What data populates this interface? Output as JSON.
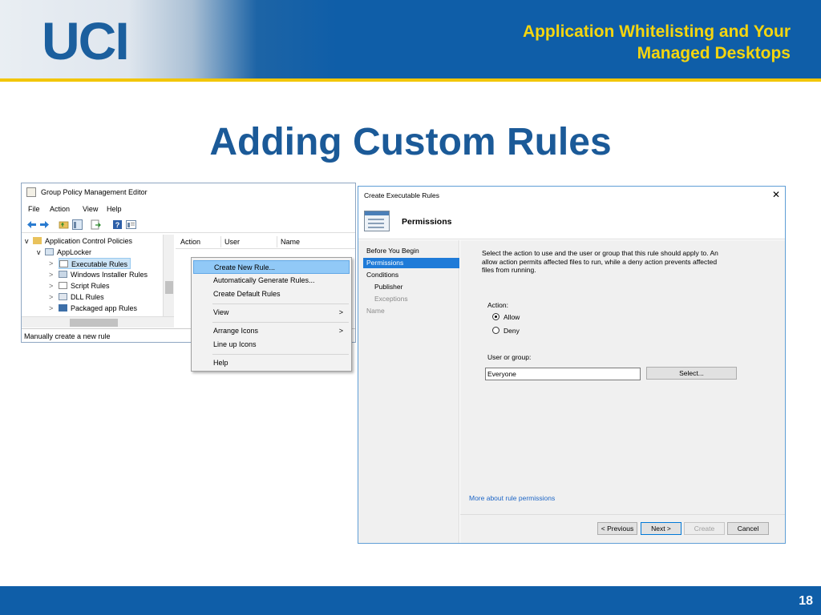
{
  "slide": {
    "logo": "UCI",
    "header_line1": "Application Whitelisting and Your",
    "header_line2": "Managed Desktops",
    "title": "Adding Custom Rules",
    "page_number": "18"
  },
  "colors": {
    "brand_blue": "#0f5ea8",
    "brand_gold": "#f2c500",
    "header_text": "#f5d50f",
    "title_blue": "#1b5a98",
    "selection": "#91c9f7",
    "active_step": "#1f7bd8"
  },
  "gpme": {
    "title": "Group Policy Management Editor",
    "menu": [
      "File",
      "Action",
      "View",
      "Help"
    ],
    "toolbar_icons": [
      "back-arrow-icon",
      "forward-arrow-icon",
      "up-folder-icon",
      "show-hide-tree-icon",
      "export-list-icon",
      "help-icon",
      "properties-icon"
    ],
    "tree": [
      {
        "label": "Application Control Policies",
        "level": 0,
        "expander": "v"
      },
      {
        "label": "AppLocker",
        "level": 1,
        "expander": "v"
      },
      {
        "label": "Executable Rules",
        "level": 2,
        "expander": ">",
        "selected": true
      },
      {
        "label": "Windows Installer Rules",
        "level": 2,
        "expander": ">"
      },
      {
        "label": "Script Rules",
        "level": 2,
        "expander": ">"
      },
      {
        "label": "DLL Rules",
        "level": 2,
        "expander": ">"
      },
      {
        "label": "Packaged app Rules",
        "level": 2,
        "expander": ">"
      }
    ],
    "columns": [
      "Action",
      "User",
      "Name"
    ],
    "status": "Manually create a new rule"
  },
  "context_menu": {
    "items": [
      "Create New Rule...",
      "Automatically Generate Rules...",
      "Create Default Rules",
      "View",
      "Arrange Icons",
      "Line up Icons",
      "Help"
    ],
    "submenu_arrow": ">"
  },
  "dialog": {
    "title": "Create Executable Rules",
    "close": "✕",
    "header": "Permissions",
    "steps": [
      "Before You Begin",
      "Permissions",
      "Conditions",
      "Publisher",
      "Exceptions",
      "Name"
    ],
    "description": "Select the action to use and the user or group that this rule should apply to. An allow action permits affected files to run, while a deny action prevents affected files from running.",
    "action_label": "Action:",
    "allow": "Allow",
    "deny": "Deny",
    "user_label": "User or group:",
    "user_value": "Everyone",
    "select_button": "Select...",
    "more_link": "More about rule permissions",
    "buttons": {
      "previous": "< Previous",
      "next": "Next >",
      "create": "Create",
      "cancel": "Cancel"
    }
  }
}
